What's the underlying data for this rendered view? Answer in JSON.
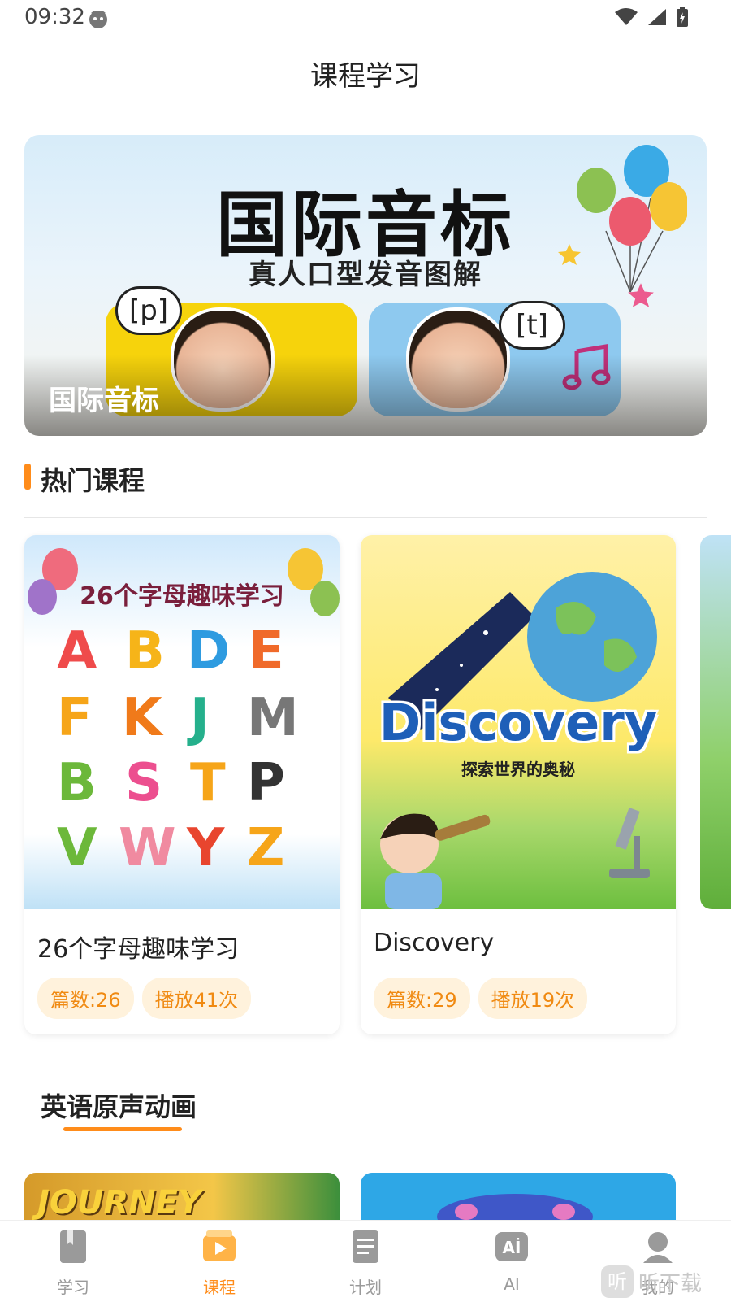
{
  "status": {
    "time": "09:32"
  },
  "page": {
    "title": "课程学习"
  },
  "banner": {
    "title": "国际音标",
    "subtitle": "真人口型发音图解",
    "bubble_left": "[p]",
    "bubble_right": "[t]",
    "caption": "国际音标"
  },
  "hot_courses": {
    "title": "热门课程",
    "items": [
      {
        "name": "26个字母趣味学习",
        "image_text": "26个字母趣味学习",
        "count_label": "篇数:26",
        "plays_label": "播放41次"
      },
      {
        "name": "Discovery",
        "image_text": "Discovery",
        "image_subtext": "探索世界的奥秘",
        "count_label": "篇数:29",
        "plays_label": "播放19次"
      }
    ]
  },
  "animations": {
    "title": "英语原声动画",
    "items": [
      {
        "image_text": "JOURNEY"
      },
      {
        "image_text": ""
      }
    ]
  },
  "tabbar": {
    "items": [
      {
        "label": "学习",
        "icon": "book-icon"
      },
      {
        "label": "课程",
        "icon": "play-icon",
        "active": true
      },
      {
        "label": "计划",
        "icon": "plan-icon"
      },
      {
        "label": "AI",
        "icon": "ai-icon"
      },
      {
        "label": "我的",
        "icon": "profile-icon"
      }
    ]
  },
  "watermark": {
    "text": "听下载",
    "logo": "听"
  },
  "colors": {
    "accent": "#ff8c1a",
    "chip_bg": "#fff2dc",
    "chip_text": "#f08a12"
  }
}
